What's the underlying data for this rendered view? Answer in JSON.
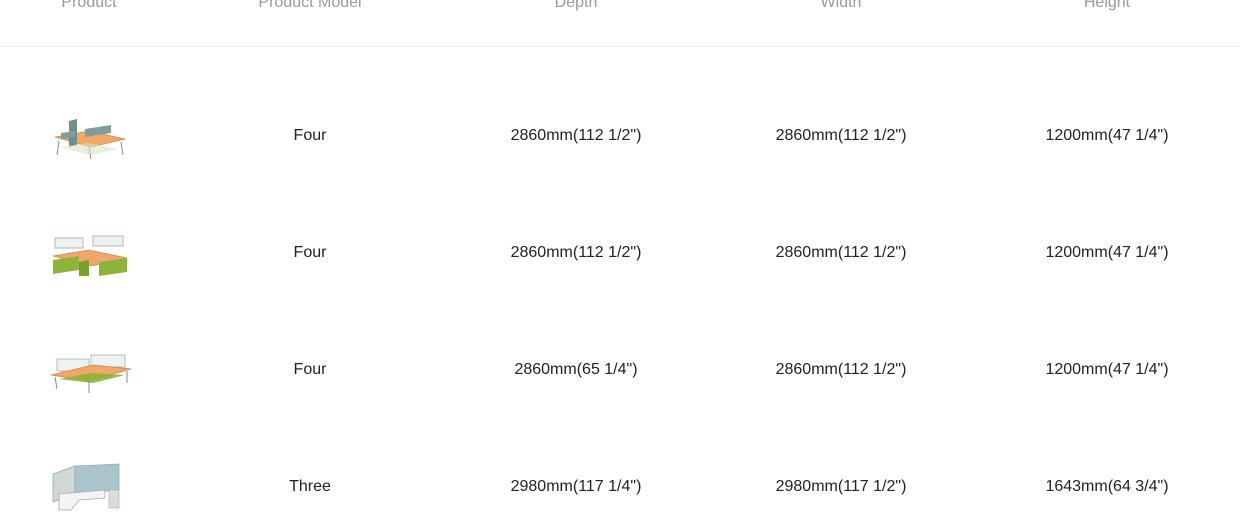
{
  "table": {
    "headers": [
      "Product",
      "Product Model",
      "Depth",
      "Width",
      "Height"
    ],
    "rows": [
      {
        "image": "cross-workstation-4-seat-image",
        "model": "Four",
        "depth": "2860mm(112 1/2\")",
        "width": "2860mm(112 1/2\")",
        "height": "1200mm(47 1/4\")"
      },
      {
        "image": "cross-workstation-4-seat-glass-image",
        "model": "Four",
        "depth": "2860mm(112 1/2\")",
        "width": "2860mm(112 1/2\")",
        "height": "1200mm(47 1/4\")"
      },
      {
        "image": "bench-workstation-4-seat-image",
        "model": "Four",
        "depth": "2860mm(65 1/4\")",
        "width": "2860mm(112 1/2\")",
        "height": "1200mm(47 1/4\")"
      },
      {
        "image": "l-shaped-workstation-3-seat-image",
        "model": "Three",
        "depth": "2980mm(117 1/4\")",
        "width": "2980mm(117 1/2\")",
        "height": "1643mm(64 3/4\")"
      }
    ]
  },
  "colors": {
    "header_text": "#9a9a9a",
    "body_text": "#222222",
    "divider": "#eeeeee",
    "desk_top": "#f2a76a",
    "panel": "#6f8f8a",
    "green": "#8db33a"
  }
}
